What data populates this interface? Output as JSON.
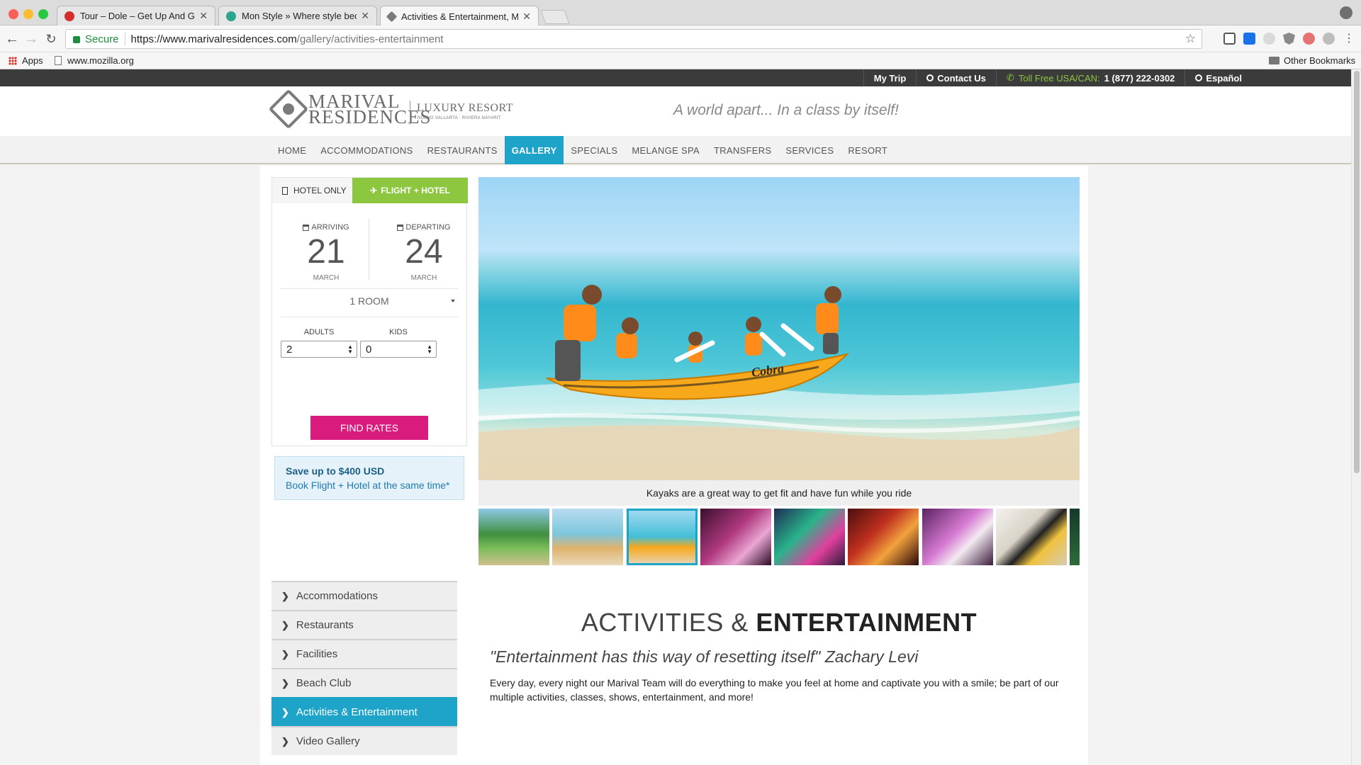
{
  "browser": {
    "tabs": [
      {
        "title": "Tour – Dole – Get Up And Grow",
        "favicon_color": "#d32f2f",
        "active": false
      },
      {
        "title": "Mon Style » Where style become",
        "favicon_color": "#2aa58e",
        "active": false
      },
      {
        "title": "Activities & Entertainment, Mar",
        "favicon_color": "#7b7b7b",
        "active": true
      }
    ],
    "close_glyph": "✕",
    "address": {
      "secure_label": "Secure",
      "host": "https://www.marivalresidences.com",
      "path": "/gallery/activities-entertainment"
    },
    "bookmarks": {
      "apps": "Apps",
      "site": "www.mozilla.org",
      "other": "Other Bookmarks"
    }
  },
  "site": {
    "topbar": {
      "my_trip": "My Trip",
      "contact": "Contact Us",
      "tollfree_label": "Toll Free USA/CAN:",
      "tollfree_number": "1 (877) 222-0302",
      "language": "Español"
    },
    "logo": {
      "line1": "MARIVAL",
      "line2": "RESIDENCES",
      "luxury": "LUXURY RESORT",
      "location": "NUEVO VALLARTA · RIVIERA NAYARIT"
    },
    "tagline": "A world apart... In a class by itself!",
    "nav": [
      "HOME",
      "ACCOMMODATIONS",
      "RESTAURANTS",
      "GALLERY",
      "SPECIALS",
      "MELANGE SPA",
      "TRANSFERS",
      "SERVICES",
      "RESORT"
    ],
    "nav_active": "GALLERY",
    "colors": {
      "accent": "#1ea3c9",
      "flight_tab": "#8dc63f",
      "find_rates": "#d91b7d"
    },
    "booking": {
      "tab_hotel": "HOTEL ONLY",
      "tab_flight": "FLIGHT + HOTEL",
      "arriving_label": "ARRIVING",
      "arriving_day": "21",
      "arriving_month": "MARCH",
      "departing_label": "DEPARTING",
      "departing_day": "24",
      "departing_month": "MARCH",
      "rooms": "1 ROOM",
      "adults_label": "ADULTS",
      "adults_value": "2",
      "kids_label": "KIDS",
      "kids_value": "0",
      "find_button": "FIND RATES"
    },
    "promo": {
      "line1": "Save up to $400 USD",
      "line2": "Book Flight + Hotel at the same time*"
    },
    "sidenav": [
      {
        "label": "Accommodations",
        "active": false
      },
      {
        "label": "Restaurants",
        "active": false
      },
      {
        "label": "Facilities",
        "active": false
      },
      {
        "label": "Beach Club",
        "active": false
      },
      {
        "label": "Activities & Entertainment",
        "active": true
      },
      {
        "label": "Video Gallery",
        "active": false
      }
    ],
    "gallery": {
      "caption": "Kayaks are a great way to get fit and have fun while you ride",
      "kayak_text": "Cobra",
      "active_thumb": 2
    },
    "article": {
      "title_light": "ACTIVITIES & ",
      "title_bold": "ENTERTAINMENT",
      "quote": "\"Entertainment has this way of resetting itself\" Zachary Levi",
      "body": "Every day, every night our Marival Team will do everything to make you feel at home and captivate you with a smile; be part of our multiple activities, classes, shows, entertainment, and more!"
    }
  }
}
